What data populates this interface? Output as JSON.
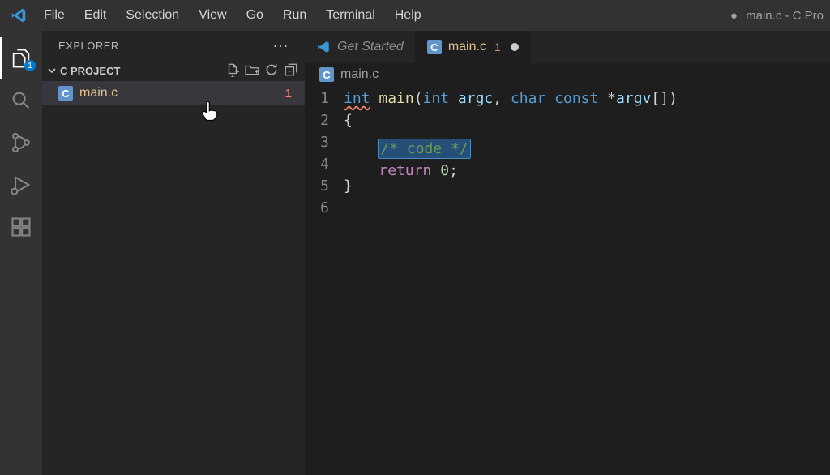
{
  "menu": {
    "items": [
      "File",
      "Edit",
      "Selection",
      "View",
      "Go",
      "Run",
      "Terminal",
      "Help"
    ],
    "window_title": "main.c - C Pro",
    "window_dirty": "●"
  },
  "activity": {
    "explorer_badge": "1"
  },
  "sidebar": {
    "title": "EXPLORER",
    "more": "···",
    "project_name": "C PROJECT",
    "file": {
      "icon_letter": "C",
      "name": "main.c",
      "errors": "1"
    }
  },
  "tabs": {
    "getStarted": {
      "label": "Get Started"
    },
    "mainc": {
      "icon_letter": "C",
      "label": "main.c",
      "error_badge": "1"
    }
  },
  "breadcrumb": {
    "icon_letter": "C",
    "path": "main.c"
  },
  "code": {
    "line_numbers": [
      "1",
      "2",
      "3",
      "4",
      "5",
      "6"
    ],
    "line1": {
      "int": "int",
      "sp": " ",
      "main": "main",
      "open": "(",
      "int2": "int",
      "argc": " argc",
      "comma": ", ",
      "char": "char",
      "const": " const ",
      "star": "*",
      "argv": "argv",
      "brackets": "[]",
      "close": ")"
    },
    "line2": {
      "brace": "{"
    },
    "line3": {
      "comment": "/* code */"
    },
    "line4": {
      "return": "return",
      "sp": " ",
      "zero": "0",
      "semi": ";"
    },
    "line5": {
      "brace": "}"
    }
  }
}
